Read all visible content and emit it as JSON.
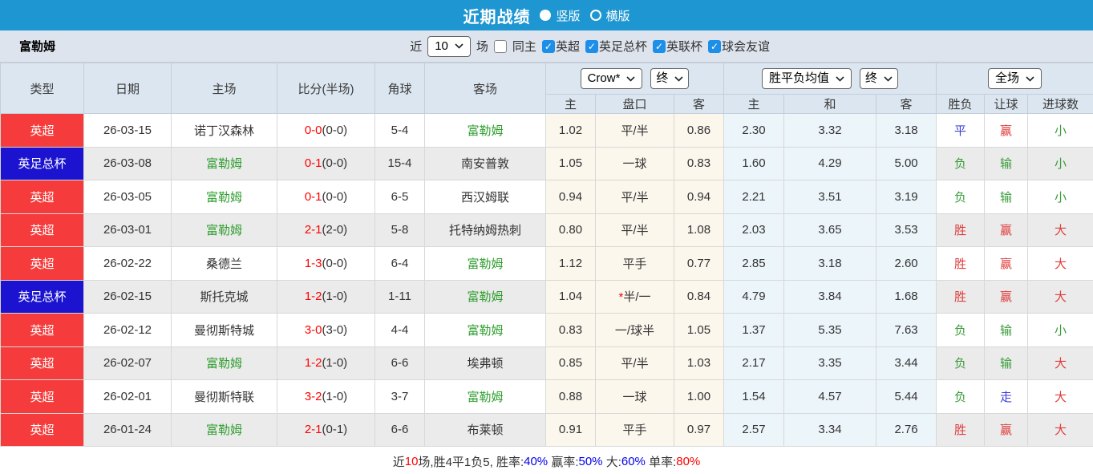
{
  "title_bar": {
    "title": "近期战绩",
    "radio_vertical": "竖版",
    "radio_horizontal": "横版"
  },
  "filter_bar": {
    "team": "富勒姆",
    "recent_label": "近",
    "recent_value": "10",
    "matches_label": "场",
    "same_home_label": "同主",
    "leagues": [
      {
        "label": "英超",
        "checked": true
      },
      {
        "label": "英足总杯",
        "checked": true
      },
      {
        "label": "英联杯",
        "checked": true
      },
      {
        "label": "球会友谊",
        "checked": true
      }
    ]
  },
  "table": {
    "headers": {
      "type": "类型",
      "date": "日期",
      "home": "主场",
      "score": "比分(半场)",
      "corner": "角球",
      "away": "客场"
    },
    "dropdowns": {
      "company": "Crow*",
      "company_time": "终",
      "avg": "胜平负均值",
      "avg_time": "终",
      "scope": "全场"
    },
    "subheaders": {
      "odds_home": "主",
      "handicap": "盘口",
      "odds_away": "客",
      "avg_home": "主",
      "avg_draw": "和",
      "avg_away": "客",
      "result": "胜负",
      "spread": "让球",
      "goals": "进球数"
    },
    "rows": [
      {
        "league": "英超",
        "league_color": "red",
        "date": "26-03-15",
        "home": "诺丁汉森林",
        "home_is_team": false,
        "score": "0-0",
        "score_half": "(0-0)",
        "corners": "5-4",
        "away": "富勒姆",
        "away_is_team": true,
        "odds_home": "1.02",
        "handicap": "平/半",
        "handicap_star": false,
        "odds_away": "0.86",
        "avg_home": "2.30",
        "avg_draw": "3.32",
        "avg_away": "3.18",
        "result": "平",
        "result_color": "blue",
        "spread": "赢",
        "spread_color": "red",
        "goals": "小",
        "goals_color": "green"
      },
      {
        "league": "英足总杯",
        "league_color": "blue",
        "date": "26-03-08",
        "home": "富勒姆",
        "home_is_team": true,
        "score": "0-1",
        "score_half": "(0-0)",
        "corners": "15-4",
        "away": "南安普敦",
        "away_is_team": false,
        "odds_home": "1.05",
        "handicap": "一球",
        "handicap_star": false,
        "odds_away": "0.83",
        "avg_home": "1.60",
        "avg_draw": "4.29",
        "avg_away": "5.00",
        "result": "负",
        "result_color": "green",
        "spread": "输",
        "spread_color": "green",
        "goals": "小",
        "goals_color": "green"
      },
      {
        "league": "英超",
        "league_color": "red",
        "date": "26-03-05",
        "home": "富勒姆",
        "home_is_team": true,
        "score": "0-1",
        "score_half": "(0-0)",
        "corners": "6-5",
        "away": "西汉姆联",
        "away_is_team": false,
        "odds_home": "0.94",
        "handicap": "平/半",
        "handicap_star": false,
        "odds_away": "0.94",
        "avg_home": "2.21",
        "avg_draw": "3.51",
        "avg_away": "3.19",
        "result": "负",
        "result_color": "green",
        "spread": "输",
        "spread_color": "green",
        "goals": "小",
        "goals_color": "green"
      },
      {
        "league": "英超",
        "league_color": "red",
        "date": "26-03-01",
        "home": "富勒姆",
        "home_is_team": true,
        "score": "2-1",
        "score_half": "(2-0)",
        "corners": "5-8",
        "away": "托特纳姆热刺",
        "away_is_team": false,
        "odds_home": "0.80",
        "handicap": "平/半",
        "handicap_star": false,
        "odds_away": "1.08",
        "avg_home": "2.03",
        "avg_draw": "3.65",
        "avg_away": "3.53",
        "result": "胜",
        "result_color": "red",
        "spread": "赢",
        "spread_color": "red",
        "goals": "大",
        "goals_color": "red"
      },
      {
        "league": "英超",
        "league_color": "red",
        "date": "26-02-22",
        "home": "桑德兰",
        "home_is_team": false,
        "score": "1-3",
        "score_half": "(0-0)",
        "corners": "6-4",
        "away": "富勒姆",
        "away_is_team": true,
        "odds_home": "1.12",
        "handicap": "平手",
        "handicap_star": false,
        "odds_away": "0.77",
        "avg_home": "2.85",
        "avg_draw": "3.18",
        "avg_away": "2.60",
        "result": "胜",
        "result_color": "red",
        "spread": "赢",
        "spread_color": "red",
        "goals": "大",
        "goals_color": "red"
      },
      {
        "league": "英足总杯",
        "league_color": "blue",
        "date": "26-02-15",
        "home": "斯托克城",
        "home_is_team": false,
        "score": "1-2",
        "score_half": "(1-0)",
        "corners": "1-11",
        "away": "富勒姆",
        "away_is_team": true,
        "odds_home": "1.04",
        "handicap": "半/一",
        "handicap_star": true,
        "odds_away": "0.84",
        "avg_home": "4.79",
        "avg_draw": "3.84",
        "avg_away": "1.68",
        "result": "胜",
        "result_color": "red",
        "spread": "赢",
        "spread_color": "red",
        "goals": "大",
        "goals_color": "red"
      },
      {
        "league": "英超",
        "league_color": "red",
        "date": "26-02-12",
        "home": "曼彻斯特城",
        "home_is_team": false,
        "score": "3-0",
        "score_half": "(3-0)",
        "corners": "4-4",
        "away": "富勒姆",
        "away_is_team": true,
        "odds_home": "0.83",
        "handicap": "一/球半",
        "handicap_star": false,
        "odds_away": "1.05",
        "avg_home": "1.37",
        "avg_draw": "5.35",
        "avg_away": "7.63",
        "result": "负",
        "result_color": "green",
        "spread": "输",
        "spread_color": "green",
        "goals": "小",
        "goals_color": "green"
      },
      {
        "league": "英超",
        "league_color": "red",
        "date": "26-02-07",
        "home": "富勒姆",
        "home_is_team": true,
        "score": "1-2",
        "score_half": "(1-0)",
        "corners": "6-6",
        "away": "埃弗顿",
        "away_is_team": false,
        "odds_home": "0.85",
        "handicap": "平/半",
        "handicap_star": false,
        "odds_away": "1.03",
        "avg_home": "2.17",
        "avg_draw": "3.35",
        "avg_away": "3.44",
        "result": "负",
        "result_color": "green",
        "spread": "输",
        "spread_color": "green",
        "goals": "大",
        "goals_color": "red"
      },
      {
        "league": "英超",
        "league_color": "red",
        "date": "26-02-01",
        "home": "曼彻斯特联",
        "home_is_team": false,
        "score": "3-2",
        "score_half": "(1-0)",
        "corners": "3-7",
        "away": "富勒姆",
        "away_is_team": true,
        "odds_home": "0.88",
        "handicap": "一球",
        "handicap_star": false,
        "odds_away": "1.00",
        "avg_home": "1.54",
        "avg_draw": "4.57",
        "avg_away": "5.44",
        "result": "负",
        "result_color": "green",
        "spread": "走",
        "spread_color": "blue",
        "goals": "大",
        "goals_color": "red"
      },
      {
        "league": "英超",
        "league_color": "red",
        "date": "26-01-24",
        "home": "富勒姆",
        "home_is_team": true,
        "score": "2-1",
        "score_half": "(0-1)",
        "corners": "6-6",
        "away": "布莱顿",
        "away_is_team": false,
        "odds_home": "0.91",
        "handicap": "平手",
        "handicap_star": false,
        "odds_away": "0.97",
        "avg_home": "2.57",
        "avg_draw": "3.34",
        "avg_away": "2.76",
        "result": "胜",
        "result_color": "red",
        "spread": "赢",
        "spread_color": "red",
        "goals": "大",
        "goals_color": "red"
      }
    ]
  },
  "footer": {
    "segments": [
      {
        "text": "近",
        "color": "black"
      },
      {
        "text": "10",
        "color": "red"
      },
      {
        "text": "场,胜4平1负5, 胜率:",
        "color": "black"
      },
      {
        "text": "40%",
        "color": "blue"
      },
      {
        "text": " 赢率:",
        "color": "black"
      },
      {
        "text": "50%",
        "color": "blue"
      },
      {
        "text": " 大:",
        "color": "black"
      },
      {
        "text": "60%",
        "color": "blue"
      },
      {
        "text": " 单率:",
        "color": "black"
      },
      {
        "text": "80%",
        "color": "red"
      }
    ]
  }
}
